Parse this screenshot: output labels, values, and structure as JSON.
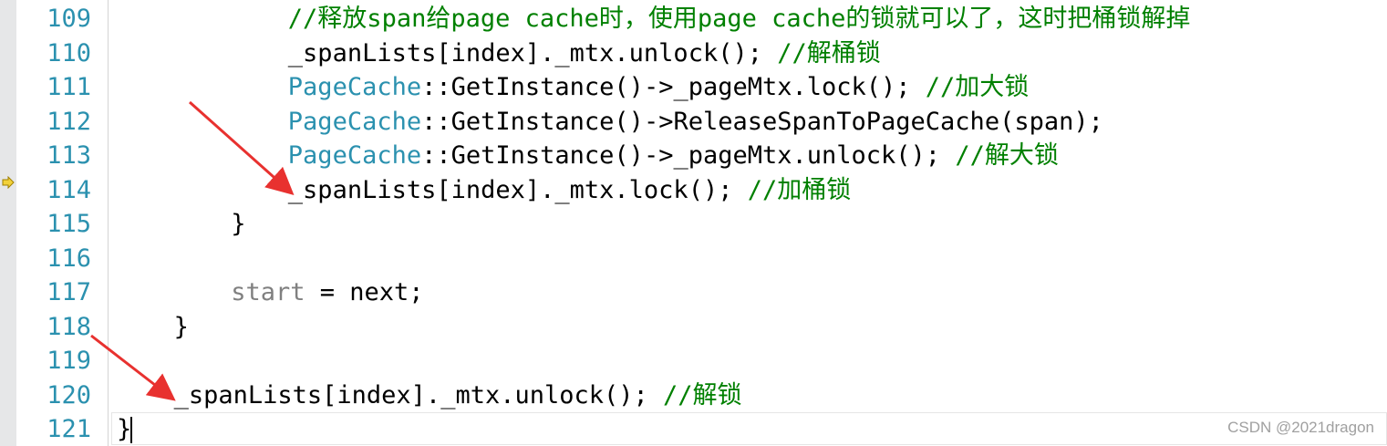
{
  "editor": {
    "lines": [
      {
        "num": "109",
        "indent": 6,
        "segments": [
          {
            "t": "//释放span给page cache时，使用page cache的锁就可以了，这时把桶锁解掉",
            "c": "comment"
          }
        ]
      },
      {
        "num": "110",
        "indent": 6,
        "segments": [
          {
            "t": "_spanLists[index]._mtx.unlock(); ",
            "c": ""
          },
          {
            "t": "//解桶锁",
            "c": "comment"
          }
        ]
      },
      {
        "num": "111",
        "indent": 6,
        "segments": [
          {
            "t": "PageCache",
            "c": "kw-type"
          },
          {
            "t": "::GetInstance()->_pageMtx.lock(); ",
            "c": ""
          },
          {
            "t": "//加大锁",
            "c": "comment"
          }
        ]
      },
      {
        "num": "112",
        "indent": 6,
        "segments": [
          {
            "t": "PageCache",
            "c": "kw-type"
          },
          {
            "t": "::GetInstance()->ReleaseSpanToPageCache(span);",
            "c": ""
          }
        ]
      },
      {
        "num": "113",
        "indent": 6,
        "segments": [
          {
            "t": "PageCache",
            "c": "kw-type"
          },
          {
            "t": "::GetInstance()->_pageMtx.unlock(); ",
            "c": ""
          },
          {
            "t": "//解大锁",
            "c": "comment"
          }
        ]
      },
      {
        "num": "114",
        "indent": 6,
        "segments": [
          {
            "t": "_spanLists[index]._mtx.lock(); ",
            "c": ""
          },
          {
            "t": "//加桶锁",
            "c": "comment"
          }
        ]
      },
      {
        "num": "115",
        "indent": 4,
        "segments": [
          {
            "t": "}",
            "c": ""
          }
        ]
      },
      {
        "num": "116",
        "indent": 0,
        "segments": []
      },
      {
        "num": "117",
        "indent": 4,
        "segments": [
          {
            "t": "start",
            "c": "var-grey"
          },
          {
            "t": " = next;",
            "c": ""
          }
        ]
      },
      {
        "num": "118",
        "indent": 2,
        "segments": [
          {
            "t": "}",
            "c": ""
          }
        ]
      },
      {
        "num": "119",
        "indent": 0,
        "segments": []
      },
      {
        "num": "120",
        "indent": 2,
        "segments": [
          {
            "t": "_spanLists[index]._mtx.unlock(); ",
            "c": ""
          },
          {
            "t": "//解锁",
            "c": "comment"
          }
        ]
      },
      {
        "num": "121",
        "indent": 0,
        "segments": [
          {
            "t": "}",
            "c": ""
          }
        ]
      }
    ]
  },
  "watermark": "CSDN @2021dragon",
  "colors": {
    "line_number": "#2b91af",
    "comment": "#008000",
    "type": "#2b91af",
    "annotation_arrow": "#e8312f"
  },
  "icons": {
    "execution_pointer": "execution-pointer-arrow-icon"
  }
}
